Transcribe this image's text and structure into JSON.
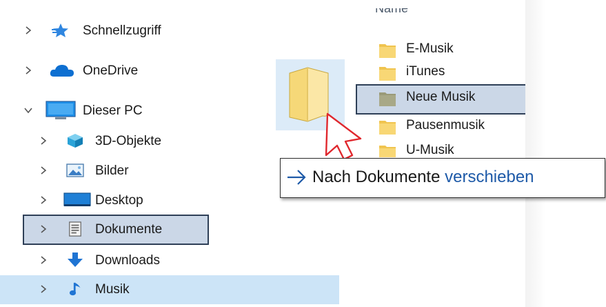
{
  "nav_pane": {
    "items": [
      {
        "label": "Schnellzugriff",
        "icon": "star-icon",
        "expanded": false
      },
      {
        "label": "OneDrive",
        "icon": "cloud-icon",
        "expanded": false
      },
      {
        "label": "Dieser PC",
        "icon": "monitor-icon",
        "expanded": true
      },
      {
        "label": "3D-Objekte",
        "icon": "cube-icon",
        "expanded": false
      },
      {
        "label": "Bilder",
        "icon": "pictures-icon",
        "expanded": false
      },
      {
        "label": "Desktop",
        "icon": "desktop-icon",
        "expanded": false
      },
      {
        "label": "Dokumente",
        "icon": "documents-icon",
        "expanded": false,
        "drop_target": true
      },
      {
        "label": "Downloads",
        "icon": "download-arrow-icon",
        "expanded": false
      },
      {
        "label": "Musik",
        "icon": "music-note-icon",
        "expanded": false,
        "selected": true
      }
    ]
  },
  "content_pane": {
    "column_header": "Name",
    "items": [
      {
        "label": "E-Musik",
        "icon": "folder-icon"
      },
      {
        "label": "iTunes",
        "icon": "folder-icon"
      },
      {
        "label": "Neue Musik",
        "icon": "folder-icon",
        "dragging": true
      },
      {
        "label": "Pausenmusik",
        "icon": "folder-icon"
      },
      {
        "label": "U-Musik",
        "icon": "folder-icon"
      }
    ]
  },
  "drag_tooltip": {
    "prefix": "Nach",
    "target": "Dokumente",
    "verb": "verschieben"
  },
  "colors": {
    "selection": "#cce4f7",
    "highlight_border": "#2e3f57",
    "folder": "#f8d775",
    "accent_blue": "#1e5aa8",
    "cursor_outline": "#e0282e"
  }
}
